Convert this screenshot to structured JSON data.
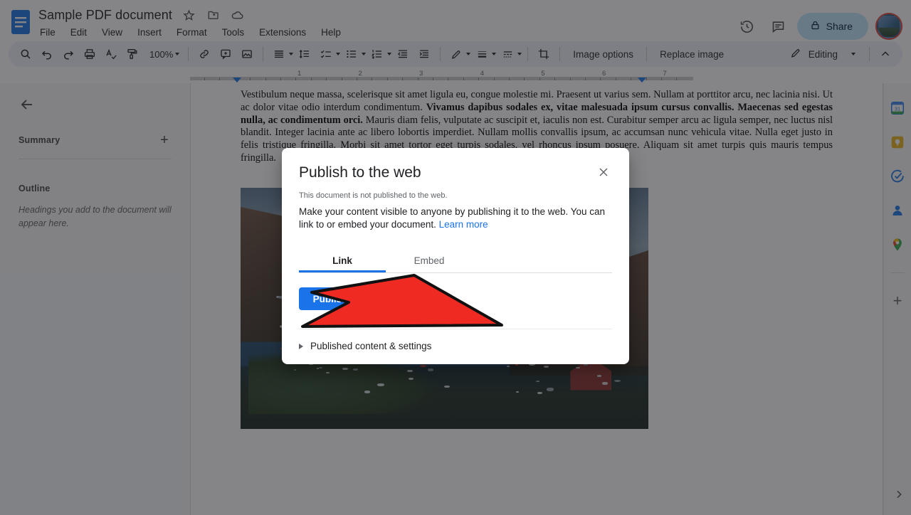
{
  "header": {
    "doc_title": "Sample PDF document",
    "doc_icon": "docs-file-icon",
    "star_icon": "star-icon",
    "move_icon": "move-to-folder-icon",
    "cloud_icon": "cloud-saved-icon",
    "menus": [
      "File",
      "Edit",
      "View",
      "Insert",
      "Format",
      "Tools",
      "Extensions",
      "Help"
    ],
    "history_icon": "version-history-icon",
    "comment_icon": "comment-icon",
    "share_label": "Share",
    "share_lock_icon": "lock-icon",
    "avatar": "user-avatar"
  },
  "toolbar": {
    "search_icon": "search-icon",
    "undo_icon": "undo-icon",
    "redo_icon": "redo-icon",
    "print_icon": "print-icon",
    "spellcheck_icon": "spellcheck-icon",
    "paint_format_icon": "paint-format-icon",
    "zoom_value": "100%",
    "link_icon": "insert-link-icon",
    "comment_add_icon": "add-comment-icon",
    "image_icon": "insert-image-icon",
    "align_icon": "align-icon",
    "line_spacing_icon": "line-spacing-icon",
    "checklist_icon": "checklist-icon",
    "bullet_list_icon": "bulleted-list-icon",
    "numbered_list_icon": "numbered-list-icon",
    "indent_less_icon": "decrease-indent-icon",
    "indent_more_icon": "increase-indent-icon",
    "border_color_icon": "border-color-icon",
    "border_weight_icon": "border-weight-icon",
    "border_dash_icon": "border-dash-icon",
    "crop_icon": "crop-icon",
    "image_options_label": "Image options",
    "replace_image_label": "Replace image",
    "mode_icon": "pencil-icon",
    "mode_label": "Editing",
    "collapse_icon": "chevron-up-icon"
  },
  "ruler": {
    "numbers": [
      "1",
      "2",
      "3",
      "4",
      "5",
      "6",
      "7"
    ],
    "left_marker": "left-indent-marker",
    "right_marker": "right-indent-marker"
  },
  "outline_pane": {
    "back_icon": "back-arrow-icon",
    "summary_label": "Summary",
    "add_summary_icon": "add-summary-icon",
    "outline_label": "Outline",
    "outline_placeholder": "Headings you add to the document will appear here."
  },
  "document": {
    "paragraph_parts": [
      {
        "text": "Vestibulum neque massa, scelerisque sit amet ligula eu, congue molestie mi. Praesent ut varius sem. Nullam at porttitor arcu, nec lacinia nisi. Ut ac dolor vitae odio interdum condimentum. ",
        "bold": false
      },
      {
        "text": "Vivamus dapibus sodales ex, vitae malesuada ipsum cursus convallis. Maecenas sed egestas nulla, ac condimentum orci.",
        "bold": true
      },
      {
        "text": " Mauris diam felis, vulputate ac suscipit et, iaculis non est. Curabitur semper arcu ac ligula semper, nec luctus nisl blandit. Integer lacinia ante ac libero lobortis imperdiet. Nullam mollis convallis ipsum, ac accumsan nunc vehicula vitae. Nulla eget justo in felis tristique fringilla. Morbi sit amet tortor eget turpis sodales, vel rhoncus ipsum posuere. Aliquam sit amet turpis quis mauris tempus fringilla.",
        "bold": false
      }
    ],
    "image_alt": "harbor-photo"
  },
  "right_rail": {
    "items": [
      {
        "name": "calendar-icon",
        "label": "31"
      },
      {
        "name": "keep-icon",
        "label": ""
      },
      {
        "name": "tasks-icon",
        "label": ""
      },
      {
        "name": "contacts-icon",
        "label": ""
      },
      {
        "name": "maps-icon",
        "label": ""
      }
    ],
    "add_icon": "add-addon-icon",
    "expand_icon": "chevron-right-icon"
  },
  "dialog": {
    "title": "Publish to the web",
    "close_icon": "close-icon",
    "status": "This document is not published to the web.",
    "description": "Make your content visible to anyone by publishing it to the web. You can link to or embed your document.",
    "learn_more": "Learn more",
    "tabs": [
      {
        "label": "Link",
        "active": true
      },
      {
        "label": "Embed",
        "active": false
      }
    ],
    "publish_label": "Publish",
    "expander_label": "Published content & settings"
  },
  "colors": {
    "accent": "#1a73e8",
    "share_chip": "#c2e7ff",
    "toolbar_bg": "#edf2fa",
    "annotation_arrow": "#ee2a23"
  }
}
